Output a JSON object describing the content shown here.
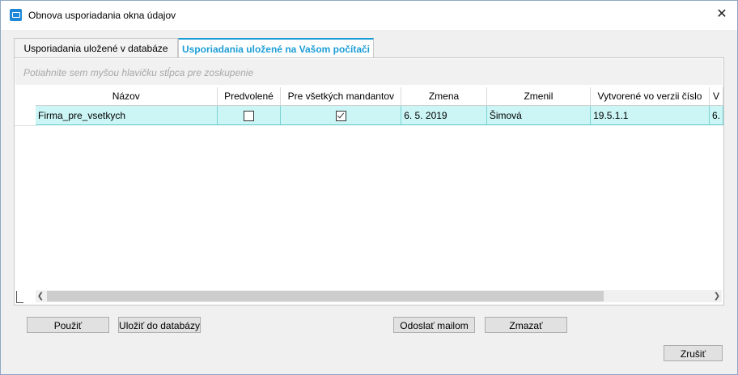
{
  "window": {
    "title": "Obnova usporiadania okna údajov"
  },
  "tabs": [
    {
      "label": "Usporiadania uložené v databáze"
    },
    {
      "label": "Usporiadania uložené na Vašom počítači"
    }
  ],
  "grid": {
    "group_hint": "Potiahnite sem myšou hlavičku stĺpca pre zoskupenie",
    "columns": [
      "Názov",
      "Predvolené",
      "Pre všetkých mandantov",
      "Zmena",
      "Zmenil",
      "Vytvorené vo verzii číslo",
      "V"
    ],
    "rows": [
      {
        "nazov": "Firma_pre_vsetkych",
        "predvolene": false,
        "pre_vsetkych": true,
        "zmena": "6. 5. 2019",
        "zmenil": "Šimová",
        "verzia": "19.5.1.1",
        "extra": "6."
      }
    ]
  },
  "buttons": {
    "use": "Použiť",
    "save_db": "Uložiť do databázy",
    "send_mail": "Odoslať mailom",
    "delete": "Zmazať",
    "cancel": "Zrušiť"
  },
  "icons": {
    "app": "window-icon",
    "close": "close-icon",
    "scroll_left": "chevron-left-icon",
    "scroll_right": "chevron-right-icon"
  }
}
